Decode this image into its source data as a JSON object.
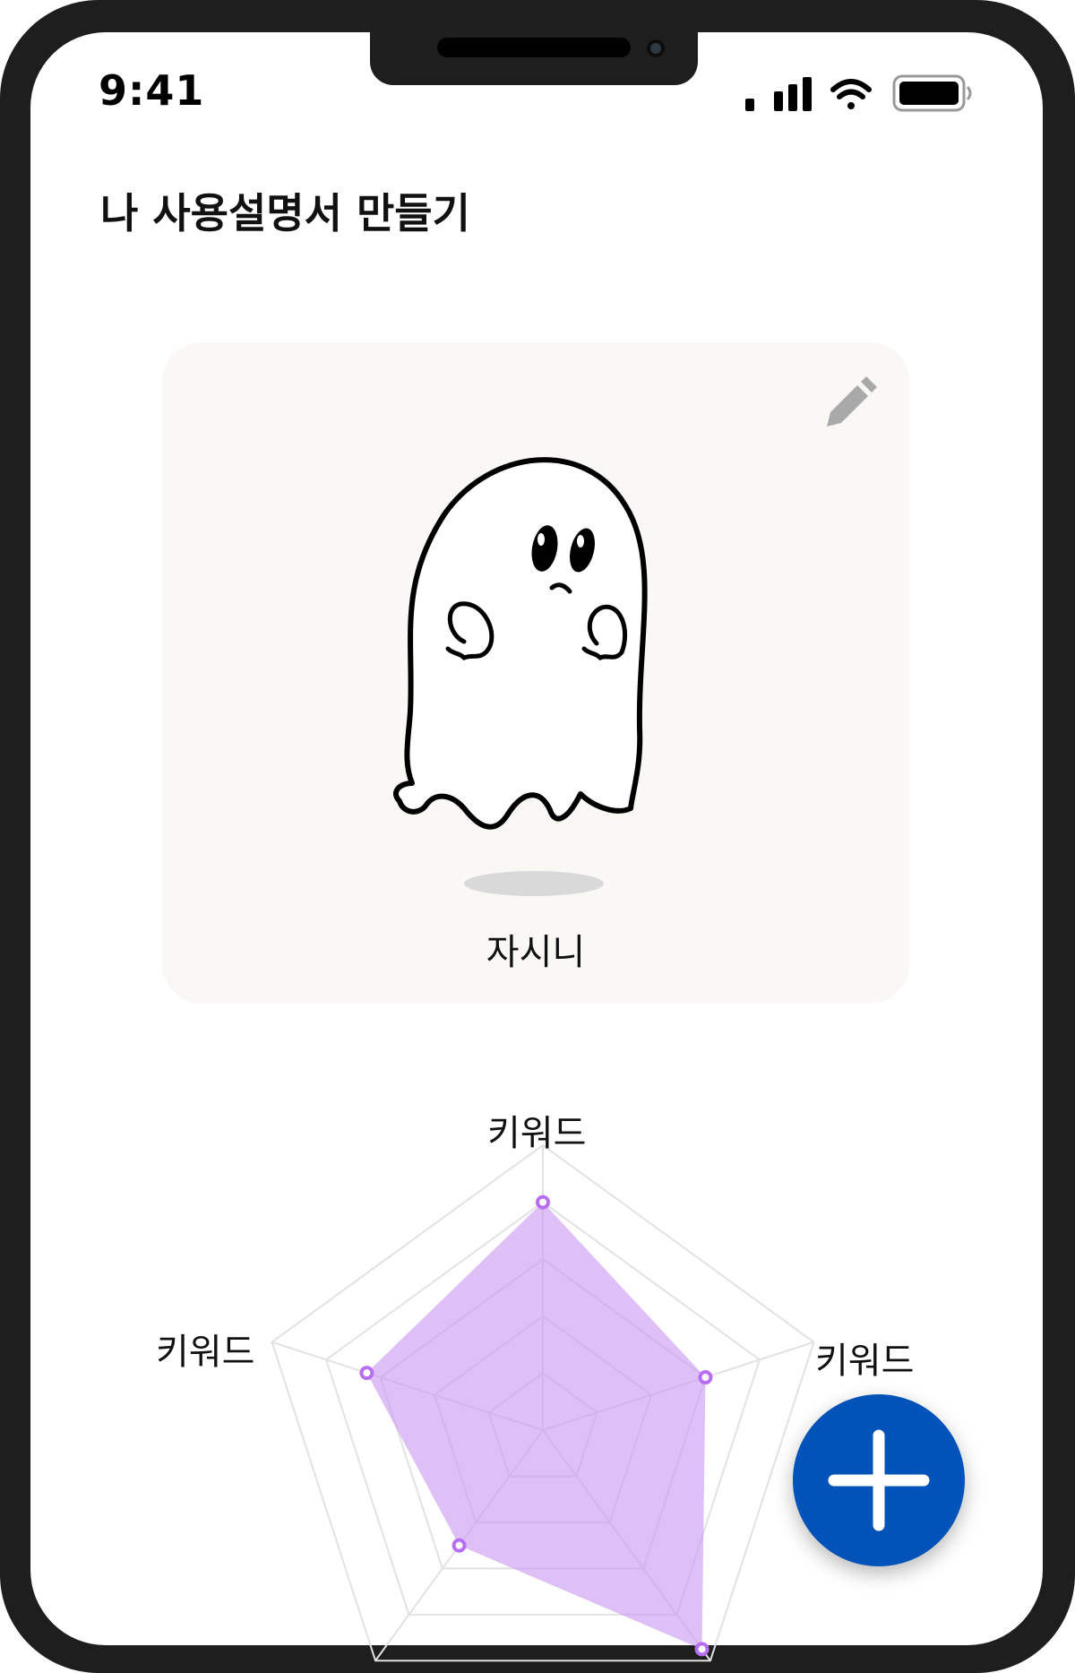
{
  "status_bar": {
    "time": "9:41",
    "icons": [
      "cellular-signal-icon",
      "wifi-icon",
      "battery-icon"
    ]
  },
  "header": {
    "title": "나 사용설명서 만들기"
  },
  "profile_card": {
    "character_name": "자시니",
    "edit_icon": "pencil-icon",
    "background_color": "#f9f8f5"
  },
  "radar_chart": {
    "labels": [
      "키워드",
      "키워드",
      "키워드"
    ],
    "fill_color": "#c99af2",
    "point_color": "#b86ef2"
  },
  "chart_data": {
    "type": "radar",
    "axes": [
      "키워드",
      "키워드",
      "",
      "",
      "키워드"
    ],
    "values": [
      0.8,
      0.6,
      0.95,
      0.5,
      0.65
    ],
    "levels": 5,
    "range": [
      0,
      1
    ]
  },
  "fab": {
    "icon": "plus-icon",
    "color": "#0253b9"
  }
}
